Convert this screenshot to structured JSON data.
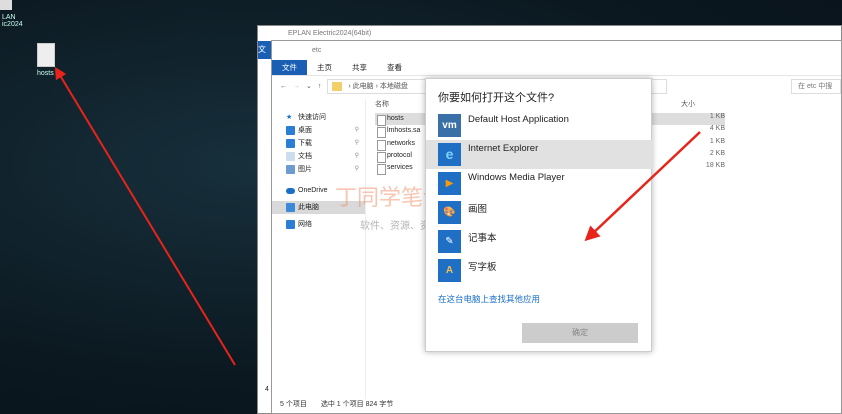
{
  "desktop": {
    "eplan_label_1": "LAN",
    "eplan_label_2": "ic2024",
    "hosts_label": "hosts"
  },
  "back_window": {
    "title": "EPLAN Electric2024(64bit)",
    "tab": "文"
  },
  "explorer": {
    "title": "etc",
    "ribbon": [
      "文件",
      "主页",
      "共享",
      "查看"
    ],
    "breadcrumb": [
      "此电脑",
      "本地磁盘"
    ],
    "search_placeholder": "在 etc 中搜",
    "sidebar": [
      {
        "label": "快速访问",
        "color": "#1a6fc7"
      },
      {
        "label": "桌面",
        "color": "#2a7fd4",
        "pin": "📌"
      },
      {
        "label": "下载",
        "color": "#2a7fd4",
        "pin": "📌"
      },
      {
        "label": "文档",
        "color": "#8ab",
        "pin": "📌"
      },
      {
        "label": "图片",
        "color": "#6b9bd0",
        "pin": "📌"
      },
      {
        "label": "OneDrive",
        "color": "#1a6fc7"
      },
      {
        "label": "此电脑",
        "color": "#3a8ad8"
      },
      {
        "label": "网络",
        "color": "#2a7fd4"
      }
    ],
    "column_name": "名称",
    "column_size": "大小",
    "files": [
      {
        "name": "hosts",
        "size": "1 KB"
      },
      {
        "name": "lmhosts.sa",
        "size": "4 KB"
      },
      {
        "name": "networks",
        "size": "1 KB"
      },
      {
        "name": "protocol",
        "size": "2 KB"
      },
      {
        "name": "services",
        "size": "18 KB"
      }
    ],
    "status": {
      "count": "5 个项目",
      "selected": "选中 1 个项目  824 字节"
    },
    "left_num": "4"
  },
  "dialog": {
    "title": "你要如何打开这个文件?",
    "apps": [
      {
        "name": "Default Host Application",
        "icon": "vm"
      },
      {
        "name": "Internet Explorer",
        "icon": "e"
      },
      {
        "name": "Windows Media Player",
        "icon": "▶"
      },
      {
        "name": "画图",
        "icon": "🎨"
      },
      {
        "name": "记事本",
        "icon": "✎"
      },
      {
        "name": "写字板",
        "icon": "A"
      }
    ],
    "more_link": "在这台电脑上查找其他应用",
    "ok": "确定"
  },
  "watermark": {
    "line1": "丁同学笔记本",
    "line2": "软件、资源、资料网盘直接分享下载"
  }
}
